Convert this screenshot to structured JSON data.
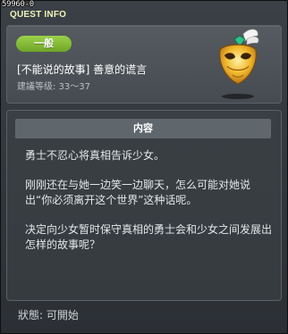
{
  "window": {
    "quest_id": "59960-0",
    "title": "QUEST INFO"
  },
  "quest": {
    "category": "一般",
    "title": "[不能说的故事] 善意的谎言",
    "level_range": "建議等级: 33～37",
    "icon": "golden-mask-icon"
  },
  "content": {
    "header": "内容",
    "paragraphs": [
      "勇士不忍心将真相告诉少女。",
      "刚刚还在与她一边笑一边聊天，怎么可能对她说出“你必须离开这个世界”这种话呢。",
      "决定向少女暂时保守真相的勇士会和少女之间发展出怎样的故事呢？"
    ]
  },
  "status": {
    "text": "狀態:  可開始"
  },
  "colors": {
    "category_pill": "#8bc43c",
    "title_text": "#f0f3b8",
    "panel_bg": "#3a3f44"
  }
}
